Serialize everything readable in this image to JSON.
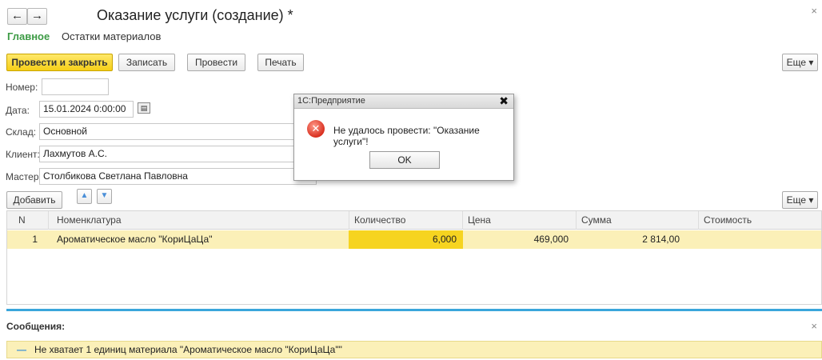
{
  "header": {
    "back": "←",
    "forward": "→",
    "title": "Оказание услуги (создание) *",
    "close": "×"
  },
  "tabs": [
    "Главное",
    "Остатки материалов"
  ],
  "toolbar": {
    "post_close": "Провести и закрыть",
    "save": "Записать",
    "post": "Провести",
    "print": "Печать",
    "more": "Еще ▾"
  },
  "form": {
    "number_label": "Номер:",
    "number_value": "",
    "date_label": "Дата:",
    "date_value": "15.01.2024  0:00:00",
    "warehouse_label": "Склад:",
    "warehouse_value": "Основной",
    "client_label": "Клиент:",
    "client_value": "Лахмутов А.С.",
    "master_label": "Мастер:",
    "master_value": "Столбикова Светлана Павловна"
  },
  "table_toolbar": {
    "add": "Добавить",
    "more": "Еще ▾"
  },
  "table": {
    "columns": [
      "N",
      "Номенклатура",
      "Количество",
      "Цена",
      "Сумма",
      "Стоимость"
    ],
    "rows": [
      {
        "n": "1",
        "item": "Ароматическое масло \"КориЦаЦа\"",
        "qty": "6,000",
        "price": "469,000",
        "sum": "2 814,00",
        "cost": ""
      }
    ]
  },
  "messages": {
    "title": "Сообщения:",
    "close": "×",
    "items": [
      "Не хватает 1 единиц материала \"Ароматическое масло \"КориЦаЦа\"\""
    ]
  },
  "dialog": {
    "title": "1С:Предприятие",
    "close": "✖",
    "message": "Не удалось провести: \"Оказание услуги\"!",
    "ok": "OK"
  },
  "colors": {
    "accent_green": "#3d9b45",
    "primary_button": "#f6cf18",
    "selected_row": "#fbf0b8",
    "separator": "#3aa6db",
    "error_icon": "#d93020"
  }
}
